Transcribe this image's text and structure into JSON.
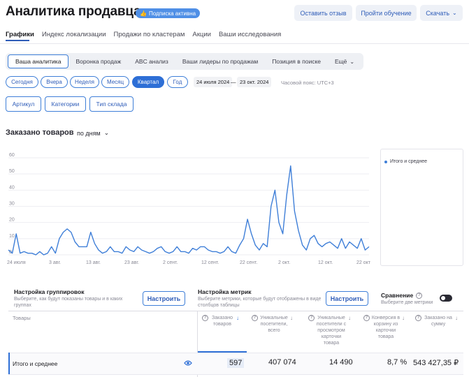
{
  "header": {
    "title": "Аналитика продавца",
    "badge": "Подписка активна",
    "buttons": {
      "feedback": "Оставить отзыв",
      "training": "Пройти обучение",
      "download": "Скачать"
    }
  },
  "nav_tabs": [
    "Графики",
    "Индекс локализации",
    "Продажи по кластерам",
    "Акции",
    "Ваши исследования"
  ],
  "segment_tabs": [
    "Ваша аналитика",
    "Воронка продаж",
    "ABC анализ",
    "Ваши лидеры по продажам",
    "Позиция в поиске",
    "Ещё"
  ],
  "periods": [
    "Сегодня",
    "Вчера",
    "Неделя",
    "Месяц",
    "Квартал",
    "Год"
  ],
  "date_range": {
    "from": "24 июля 2024",
    "dash": "—",
    "to": "23 окт. 2024"
  },
  "timezone": "Часовой пояс: UTC+3",
  "filters": [
    "Артикул",
    "Категории",
    "Тип склада"
  ],
  "chart_section": {
    "title": "Заказано товаров",
    "granularity": "по дням"
  },
  "chart_data": {
    "type": "line",
    "title": "Заказано товаров",
    "ylim": [
      0,
      60
    ],
    "y_ticks": [
      "0",
      "10",
      "20",
      "30",
      "40",
      "50",
      "60"
    ],
    "x_ticks": [
      "24 июля",
      "3 авг.",
      "13 авг.",
      "23 авг.",
      "2 сент.",
      "12 сент.",
      "22 сент.",
      "2 окт.",
      "12 окт.",
      "22 окт"
    ],
    "series": [
      {
        "name": "Итого и среднее",
        "color": "#3f7fd8",
        "values": [
          3,
          1,
          13,
          1,
          2,
          1,
          1,
          0,
          2,
          0,
          1,
          5,
          1,
          10,
          14,
          16,
          14,
          8,
          5,
          5,
          5,
          14,
          7,
          3,
          1,
          2,
          5,
          2,
          2,
          1,
          5,
          3,
          2,
          5,
          3,
          2,
          1,
          2,
          4,
          5,
          2,
          1,
          2,
          5,
          2,
          2,
          1,
          4,
          3,
          5,
          5,
          3,
          2,
          2,
          1,
          2,
          5,
          2,
          1,
          6,
          10,
          22,
          13,
          6,
          3,
          7,
          5,
          30,
          40,
          20,
          13,
          37,
          55,
          27,
          15,
          6,
          3,
          10,
          12,
          7,
          5,
          7,
          8,
          6,
          4,
          10,
          4,
          8,
          6,
          4,
          10,
          3,
          5
        ]
      }
    ]
  },
  "legend": {
    "item": "Итого и среднее"
  },
  "grouping": {
    "title": "Настройка группировок",
    "hint": "Выберите, как будут показаны товары и в каких группах",
    "button": "Настроить"
  },
  "metrics": {
    "title": "Настройка метрик",
    "hint": "Выберите метрики, которые будут отображены в виде столбцов таблицы",
    "button": "Настроить"
  },
  "comparison": {
    "title": "Сравнение",
    "hint": "Выберите две метрики",
    "toggle_on": false
  },
  "table": {
    "goods_header": "Товары",
    "columns": [
      "Заказано товаров",
      "Уникальные посетители, всего",
      "Уникальные посетители с просмотром карточки товара",
      "Конверсия в корзину из карточки товара",
      "Заказано на сумму"
    ],
    "row": {
      "label": "Итого и среднее",
      "values": [
        "597",
        "407 074",
        "14 490",
        "8,7 %",
        "543 427,35 ₽"
      ]
    }
  }
}
